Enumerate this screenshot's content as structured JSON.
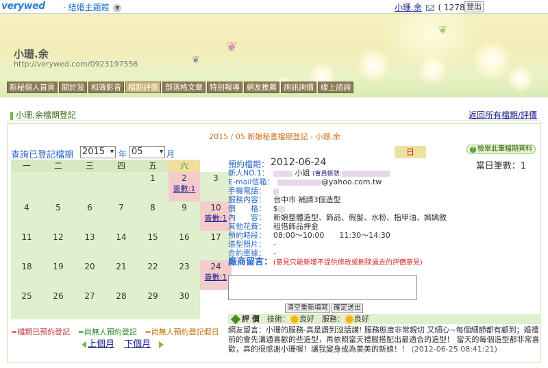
{
  "topbar": {
    "logo": "verywed",
    "theme": "· 結婚主題館",
    "user": "小珊.余",
    "points": "( 1278 )",
    "logout": "登出"
  },
  "banner": {
    "title": "小珊.余",
    "url": "http://verywed.com/0923197556",
    "nav": [
      "新秘個人首頁",
      "關於我",
      "相簿影音",
      "檔期評價",
      "部落格文章",
      "特別報導",
      "網友推薦",
      "詢訊詢價",
      "線上諮詢"
    ],
    "active_nav": "檔期評價"
  },
  "section": {
    "title": "小珊.余檔期登記",
    "back": "返回所有檔期/評價"
  },
  "month_title": "2015 / 05 新娘秘書檔期登記 - 小珊.余",
  "query": {
    "label": "查詢已登記檔期",
    "year": "2015",
    "year_unit": "年",
    "month": "05",
    "month_unit": "月"
  },
  "calendar": {
    "weekdays": [
      "一",
      "二",
      "三",
      "四",
      "五",
      "六",
      "日"
    ],
    "booked_label": "簽數:1",
    "rows": [
      [
        "",
        "",
        "",
        "",
        "1",
        "2",
        "3"
      ],
      [
        "4",
        "5",
        "6",
        "7",
        "8",
        "9",
        "10"
      ],
      [
        "11",
        "12",
        "13",
        "14",
        "15",
        "16",
        "17"
      ],
      [
        "18",
        "19",
        "20",
        "21",
        "22",
        "23",
        "24"
      ],
      [
        "25",
        "26",
        "27",
        "28",
        "29",
        "30",
        ""
      ]
    ]
  },
  "legend": {
    "booked": "=檔期已預約登記",
    "none": "=尚無人預約登記",
    "none_holiday": "=尚無人預約登記假日"
  },
  "month_nav": {
    "prev": "上個月",
    "next": "下個月"
  },
  "view_all": "檢舉此筆檔期資料",
  "detail": {
    "date_label": "預約檔期：",
    "date": "2012-06-24",
    "count_label": "當日筆數：1",
    "fields": {
      "newlywed_label": "新人NO.1：",
      "newlywed_value": "小姐",
      "member_label": "(會員帳號:",
      "email_label": "E-mail信箱：",
      "email_value": "@yahoo.com.tw",
      "phone_label": "手機電話：",
      "service_label": "服務內容：",
      "service_value": "台中市 補請3個造型",
      "price_label": "價　　格：",
      "price_value": "$",
      "content_label": "內　　容：",
      "content_value": "新娘整體造型、飾品、假髮、水粉、指甲油、嫣嫣敘",
      "other_label": "其他花費：",
      "other_value": "租借飾品押金",
      "time_label": "預約時段：",
      "time_value": "08:00～10:00　　11:30～14:30",
      "photo_label": "造型照片：",
      "photo_value": "-",
      "contract_label": "合約單據：",
      "contract_value": "-"
    },
    "vendor_label": "廠商留言：",
    "vendor_note": "(意見只能新增不提供修改或刪除過去的評價意見)",
    "clear_btn": "清空重新填寫",
    "submit_btn": "確定送出"
  },
  "review": {
    "label": "評 價",
    "skill_label": "技術：",
    "skill_value": "良好",
    "service_label": "服務：",
    "service_value": "良好",
    "text": "網友留言：小珊的服務-真是讚到沒話講! 服務態度非常親切 又細心~每個細節都有顧到；婚禮前的會先溝通喜歡的些造型，再依照當天禮服搭配出最適合的造型！ 當天的每個造型都非常喜歡，真的很感謝小珊喔！讓我變身成為美美的新娘！！",
    "date": "(2012-06-25 08:41:21)"
  }
}
